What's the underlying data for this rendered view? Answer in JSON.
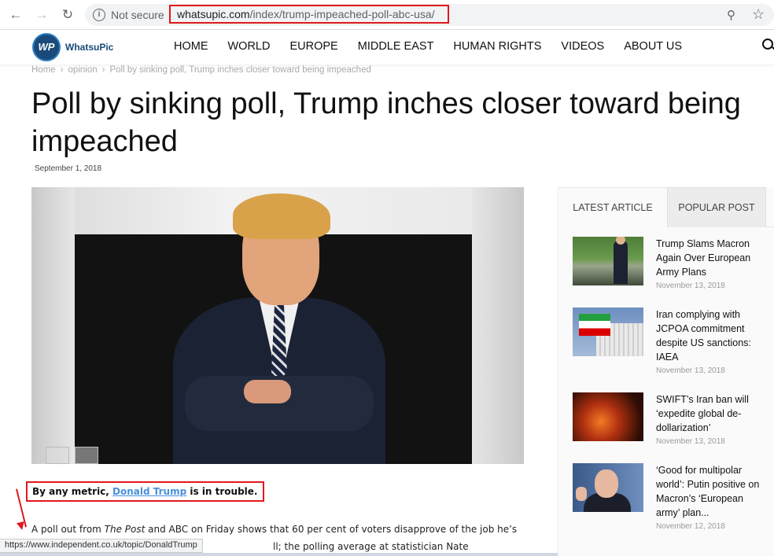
{
  "browser": {
    "security_label": "Not secure",
    "url_domain": "whatsupic.com",
    "url_path": "/index/trump-impeached-poll-abc-usa/",
    "status_url": "https://www.independent.co.uk/topic/DonaldTrump"
  },
  "site": {
    "logo_mark": "WP",
    "logo_text": "WhatsuPic",
    "menu": [
      "HOME",
      "WORLD",
      "EUROPE",
      "MIDDLE EAST",
      "HUMAN RIGHTS",
      "VIDEOS",
      "ABOUT US"
    ]
  },
  "breadcrumb": {
    "home": "Home",
    "category": "opinion",
    "current": "Poll by sinking poll, Trump inches closer toward being impeached"
  },
  "article": {
    "title": "Poll by sinking poll, Trump inches closer toward being impeached",
    "date": "September 1, 2018",
    "lead_before": "By any metric, ",
    "lead_link": "Donald Trump",
    "lead_after": " is in trouble.",
    "para1_before": "A poll out from ",
    "para1_em": "The Post",
    "para1_after": " and ABC on Friday shows that 60 per cent of voters disapprove of the job he’s",
    "para2": "ll; the polling average at statistician Nate"
  },
  "sidebar": {
    "tabs": [
      "LATEST ARTICLE",
      "POPULAR POST"
    ],
    "articles": [
      {
        "title": "Trump Slams Macron Again Over European Army Plans",
        "date": "November 13, 2018"
      },
      {
        "title": "Iran complying with JCPOA commitment despite US sanctions: IAEA",
        "date": "November 13, 2018"
      },
      {
        "title": "SWIFT’s Iran ban will ‘expedite global de-dollarization’",
        "date": "November 13, 2018"
      },
      {
        "title": "‘Good for multipolar world’: Putin positive on Macron’s ‘European army’ plan...",
        "date": "November 12, 2018"
      }
    ]
  },
  "colors": {
    "annotation_red": "#e0191e",
    "link_blue": "#4a90d9",
    "logo_navy": "#1a4a7a"
  }
}
